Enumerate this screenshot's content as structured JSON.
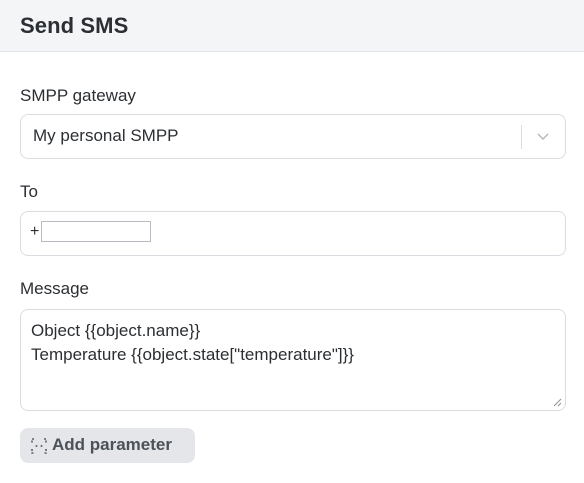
{
  "header": {
    "title": "Send SMS"
  },
  "form": {
    "gateway": {
      "label": "SMPP gateway",
      "selected": "My personal SMPP",
      "chevron_icon": "chevron-down-icon"
    },
    "to": {
      "label": "To",
      "prefix": "+",
      "value": ""
    },
    "message": {
      "label": "Message",
      "value": "Object {{object.name}}\nTemperature {{object.state[\"temperature\"]}}"
    },
    "add_parameter": {
      "label": "Add parameter",
      "icon": "braces-icon"
    }
  },
  "colors": {
    "header_bg": "#f4f5f7",
    "border": "#d9dde2",
    "button_bg": "#e4e6e9",
    "text": "#2b2f33"
  }
}
